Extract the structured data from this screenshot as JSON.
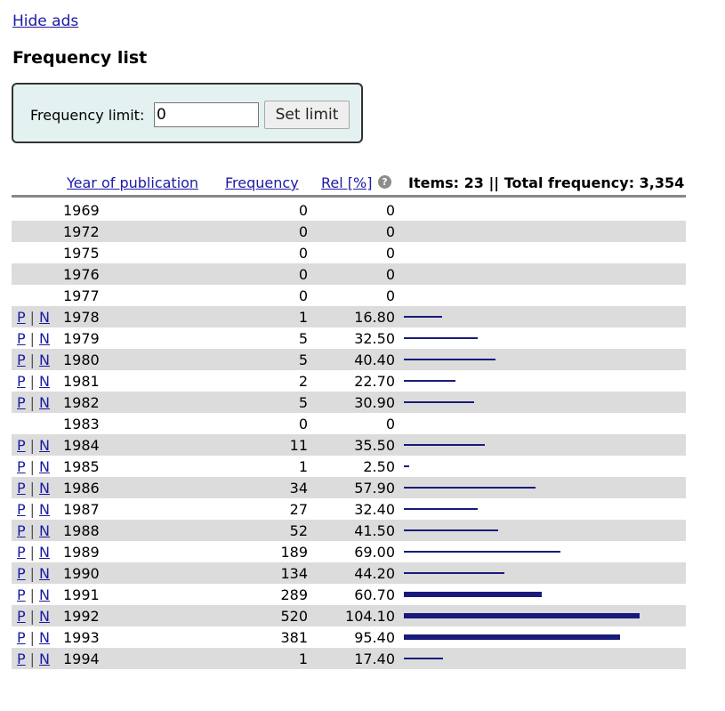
{
  "hide_ads": "Hide ads",
  "title": "Frequency list",
  "limit": {
    "label": "Frequency limit:",
    "value": "0",
    "button": "Set limit"
  },
  "header": {
    "year": "Year of publication",
    "frequency": "Frequency",
    "rel": "Rel [%]",
    "help_icon": "question-circle-icon",
    "summary": "Items: 23 || Total frequency: 3,354"
  },
  "link_labels": {
    "p": "P",
    "n": "N",
    "sep": "|"
  },
  "colors": {
    "link": "#1a1aa6",
    "bar": "#1a1a7c",
    "alt_row": "#dcdcdc",
    "limit_box": "#e4f1f1"
  },
  "rows": [
    {
      "year": "1969",
      "freq": "0",
      "rel": "0",
      "rel_value": 0,
      "links": false
    },
    {
      "year": "1972",
      "freq": "0",
      "rel": "0",
      "rel_value": 0,
      "links": false
    },
    {
      "year": "1975",
      "freq": "0",
      "rel": "0",
      "rel_value": 0,
      "links": false
    },
    {
      "year": "1976",
      "freq": "0",
      "rel": "0",
      "rel_value": 0,
      "links": false
    },
    {
      "year": "1977",
      "freq": "0",
      "rel": "0",
      "rel_value": 0,
      "links": false
    },
    {
      "year": "1978",
      "freq": "1",
      "rel": "16.80",
      "rel_value": 16.8,
      "links": true
    },
    {
      "year": "1979",
      "freq": "5",
      "rel": "32.50",
      "rel_value": 32.5,
      "links": true
    },
    {
      "year": "1980",
      "freq": "5",
      "rel": "40.40",
      "rel_value": 40.4,
      "links": true
    },
    {
      "year": "1981",
      "freq": "2",
      "rel": "22.70",
      "rel_value": 22.7,
      "links": true
    },
    {
      "year": "1982",
      "freq": "5",
      "rel": "30.90",
      "rel_value": 30.9,
      "links": true
    },
    {
      "year": "1983",
      "freq": "0",
      "rel": "0",
      "rel_value": 0,
      "links": false
    },
    {
      "year": "1984",
      "freq": "11",
      "rel": "35.50",
      "rel_value": 35.5,
      "links": true
    },
    {
      "year": "1985",
      "freq": "1",
      "rel": "2.50",
      "rel_value": 2.5,
      "links": true
    },
    {
      "year": "1986",
      "freq": "34",
      "rel": "57.90",
      "rel_value": 57.9,
      "links": true
    },
    {
      "year": "1987",
      "freq": "27",
      "rel": "32.40",
      "rel_value": 32.4,
      "links": true
    },
    {
      "year": "1988",
      "freq": "52",
      "rel": "41.50",
      "rel_value": 41.5,
      "links": true
    },
    {
      "year": "1989",
      "freq": "189",
      "rel": "69.00",
      "rel_value": 69.0,
      "links": true
    },
    {
      "year": "1990",
      "freq": "134",
      "rel": "44.20",
      "rel_value": 44.2,
      "links": true
    },
    {
      "year": "1991",
      "freq": "289",
      "rel": "60.70",
      "rel_value": 60.7,
      "links": true
    },
    {
      "year": "1992",
      "freq": "520",
      "rel": "104.10",
      "rel_value": 104.1,
      "links": true
    },
    {
      "year": "1993",
      "freq": "381",
      "rel": "95.40",
      "rel_value": 95.4,
      "links": true
    },
    {
      "year": "1994",
      "freq": "1",
      "rel": "17.40",
      "rel_value": 17.4,
      "links": true
    }
  ]
}
